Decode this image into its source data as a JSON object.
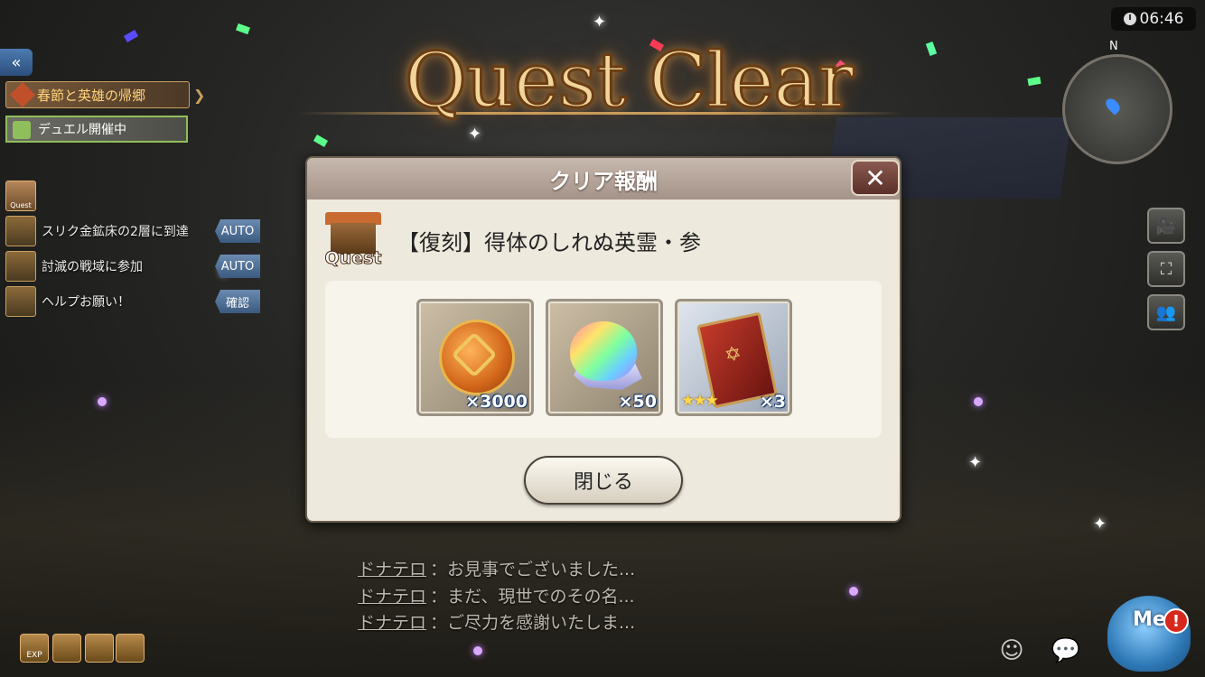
{
  "title": "Quest Clear",
  "clock": {
    "time": "06:46"
  },
  "minimap": {
    "north": "N"
  },
  "hud_left": {
    "back_icon": "double-chevron-left-icon",
    "event_banner": "春節と英雄の帰郷",
    "duel_banner": "デュエル開催中",
    "quest_mini_label": "Quest",
    "tasks": [
      {
        "text": "スリク金鉱床の2層に到達",
        "button": "AUTO"
      },
      {
        "text": "討滅の戦域に参加",
        "button": "AUTO"
      },
      {
        "text": "ヘルプお願い！",
        "button": "確認"
      }
    ]
  },
  "hud_right": {
    "buttons": [
      "camera-icon",
      "auto-icon",
      "party-icon"
    ]
  },
  "modal": {
    "header": "クリア報酬",
    "close_symbol": "✕",
    "quest_badge": "Quest",
    "quest_name": "【復刻】得体のしれぬ英霊・参",
    "rewards": [
      {
        "item": "coin",
        "icon": "coin-knot-icon",
        "quantity": "×3000",
        "stars": ""
      },
      {
        "item": "crystal",
        "icon": "rainbow-crystal-icon",
        "quantity": "×50",
        "stars": ""
      },
      {
        "item": "book",
        "icon": "spellbook-icon",
        "quantity": "×3",
        "stars": "★★★"
      }
    ],
    "close_button": "閉じる"
  },
  "chat": [
    {
      "speaker": "ドナテロ",
      "text": "：お見事でございました..."
    },
    {
      "speaker": "ドナテロ",
      "text": "：まだ、現世でのその名..."
    },
    {
      "speaker": "ドナテロ",
      "text": "：ご尽力を感謝いたしま..."
    }
  ],
  "bottom_hud": {
    "exp_label": "EXP",
    "me_label": "Me",
    "alert": "!"
  }
}
